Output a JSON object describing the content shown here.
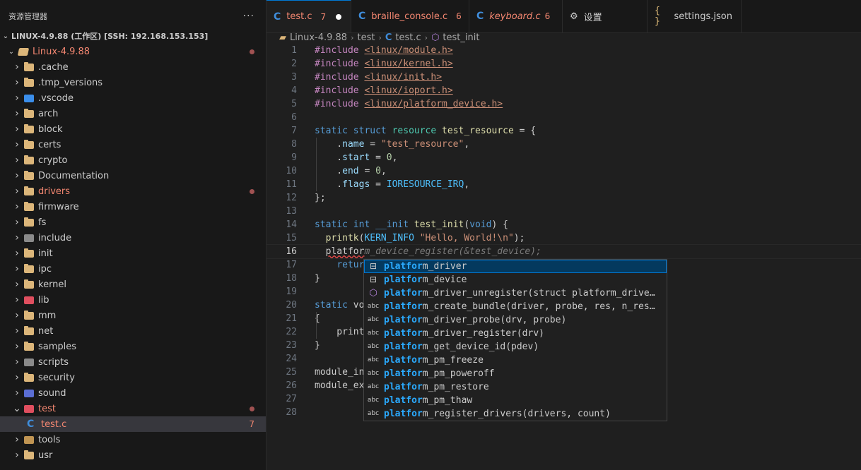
{
  "sidebar": {
    "title": "资源管理器",
    "more_icon": "ellipsis-icon",
    "workspace": "LINUX-4.9.88 (工作区) [SSH: 192.168.153.153]",
    "root_folder": "Linux-4.9.88",
    "items": [
      {
        "label": ".cache",
        "icon": "folder-icon"
      },
      {
        "label": ".tmp_versions",
        "icon": "folder-icon"
      },
      {
        "label": ".vscode",
        "icon": "vscode-folder-icon"
      },
      {
        "label": "arch",
        "icon": "folder-icon"
      },
      {
        "label": "block",
        "icon": "folder-icon"
      },
      {
        "label": "certs",
        "icon": "folder-icon"
      },
      {
        "label": "crypto",
        "icon": "folder-icon"
      },
      {
        "label": "Documentation",
        "icon": "folder-icon"
      },
      {
        "label": "drivers",
        "icon": "folder-icon",
        "modified": true
      },
      {
        "label": "firmware",
        "icon": "folder-icon"
      },
      {
        "label": "fs",
        "icon": "folder-icon"
      },
      {
        "label": "include",
        "icon": "include-folder-icon"
      },
      {
        "label": "init",
        "icon": "folder-icon"
      },
      {
        "label": "ipc",
        "icon": "folder-icon"
      },
      {
        "label": "kernel",
        "icon": "folder-icon"
      },
      {
        "label": "lib",
        "icon": "lib-folder-icon"
      },
      {
        "label": "mm",
        "icon": "folder-icon"
      },
      {
        "label": "net",
        "icon": "folder-icon"
      },
      {
        "label": "samples",
        "icon": "folder-icon"
      },
      {
        "label": "scripts",
        "icon": "scripts-folder-icon"
      },
      {
        "label": "security",
        "icon": "folder-icon"
      },
      {
        "label": "sound",
        "icon": "sound-folder-icon"
      },
      {
        "label": "test",
        "icon": "test-folder-icon",
        "expanded": true,
        "modified": true
      },
      {
        "label": "test.c",
        "icon": "c-file-icon",
        "file": true,
        "count": "7"
      },
      {
        "label": "tools",
        "icon": "tools-folder-icon"
      },
      {
        "label": "usr",
        "icon": "folder-icon"
      }
    ]
  },
  "tabs": [
    {
      "label": "test.c",
      "badge": "7",
      "icon": "c-file-icon",
      "active": true
    },
    {
      "label": "braille_console.c",
      "badge": "6",
      "icon": "c-file-icon"
    },
    {
      "label": "keyboard.c",
      "badge": "6",
      "icon": "c-file-icon"
    },
    {
      "label": "设置",
      "icon": "gear-icon"
    },
    {
      "label": "settings.json",
      "icon": "json-icon"
    }
  ],
  "breadcrumbs": [
    "Linux-4.9.88",
    "test",
    "test.c",
    "test_init"
  ],
  "editor": {
    "lines": [
      "#include <linux/module.h>",
      "#include <linux/kernel.h>",
      "#include <linux/init.h>",
      "#include <linux/ioport.h>",
      "#include <linux/platform_device.h>",
      "",
      "static struct resource test_resource = {",
      "    .name = \"test_resource\",",
      "    .start = 0,",
      "    .end = 0,",
      "    .flags = IORESOURCE_IRQ,",
      "};",
      "",
      "static int __init test_init(void) {",
      "  printk(KERN_INFO \"Hello, World!\\n\");",
      "  platform_device_register(&test_device);",
      "    return",
      "}",
      "",
      "static vo",
      "{",
      "    print",
      "}",
      "",
      "module_in",
      "module_ex",
      "",
      ""
    ],
    "typed_prefix": "platfor",
    "ghost_text": "m_device_register(&test_device);",
    "current_line": 16
  },
  "suggestions": {
    "match": "platfor",
    "items": [
      {
        "rest": "m_driver",
        "icon": "struct-icon",
        "icon_text": "⊟"
      },
      {
        "rest": "m_device",
        "icon": "struct-icon",
        "icon_text": "⊟"
      },
      {
        "rest": "m_driver_unregister(struct platform_drive…",
        "icon": "method-icon",
        "icon_text": "⬡"
      },
      {
        "rest": "m_create_bundle(driver, probe, res, n_res…",
        "icon": "text-icon",
        "icon_text": "abc"
      },
      {
        "rest": "m_driver_probe(drv, probe)",
        "icon": "text-icon",
        "icon_text": "abc"
      },
      {
        "rest": "m_driver_register(drv)",
        "icon": "text-icon",
        "icon_text": "abc"
      },
      {
        "rest": "m_get_device_id(pdev)",
        "icon": "text-icon",
        "icon_text": "abc"
      },
      {
        "rest": "m_pm_freeze",
        "icon": "text-icon",
        "icon_text": "abc"
      },
      {
        "rest": "m_pm_poweroff",
        "icon": "text-icon",
        "icon_text": "abc"
      },
      {
        "rest": "m_pm_restore",
        "icon": "text-icon",
        "icon_text": "abc"
      },
      {
        "rest": "m_pm_thaw",
        "icon": "text-icon",
        "icon_text": "abc"
      },
      {
        "rest": "m_register_drivers(drivers, count)",
        "icon": "text-icon",
        "icon_text": "abc"
      }
    ]
  },
  "colors": {
    "accent": "#0078d4",
    "modified_text": "#f48771",
    "match_highlight": "#2aaaff"
  }
}
